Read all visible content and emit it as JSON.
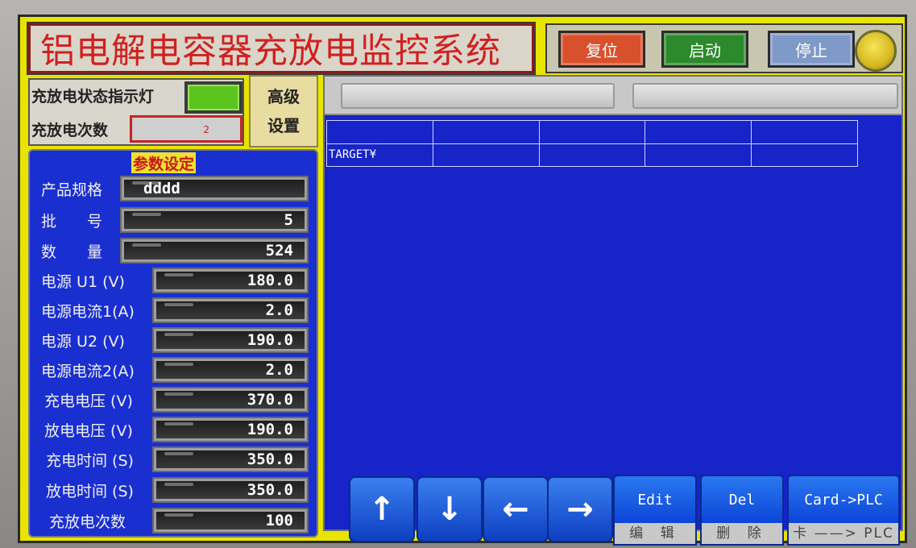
{
  "title": "铝电解电容器充放电监控系统",
  "top_buttons": {
    "reset": "复位",
    "start": "启动",
    "stop": "停止"
  },
  "status": {
    "lamp_label": "充放电状态指示灯",
    "count_label": "充放电次数",
    "count_value": "2"
  },
  "advanced": {
    "line1": "高级",
    "line2": "设置"
  },
  "params": {
    "title": "参数设定",
    "rows": [
      {
        "label": "产品规格",
        "value": "dddd"
      },
      {
        "label": "批　　号",
        "value": "5"
      },
      {
        "label": "数　　量",
        "value": "524"
      },
      {
        "label": "电源 U1  (V)",
        "value": "180.0"
      },
      {
        "label": "电源电流1(A)",
        "value": "2.0"
      },
      {
        "label": "电源 U2  (V)",
        "value": "190.0"
      },
      {
        "label": "电源电流2(A)",
        "value": "2.0"
      },
      {
        "label": "充电电压 (V)",
        "value": "370.0"
      },
      {
        "label": "放电电压 (V)",
        "value": "190.0"
      },
      {
        "label": "充电时间 (S)",
        "value": "350.0"
      },
      {
        "label": "放电时间 (S)",
        "value": "350.0"
      },
      {
        "label": "充放电次数",
        "value": "100"
      }
    ]
  },
  "grid": {
    "row1": [
      "",
      "",
      "",
      "",
      ""
    ],
    "row2": [
      "TARGET¥",
      "",
      "",
      "",
      ""
    ]
  },
  "nav": {
    "up": "↑",
    "down": "↓",
    "left": "←",
    "right": "→"
  },
  "ops": {
    "edit": {
      "label": "Edit",
      "sub": "编 辑"
    },
    "del": {
      "label": "Del",
      "sub": "删 除"
    },
    "card": {
      "label": "Card->PLC",
      "sub": "卡 ——> PLC"
    }
  },
  "colors": {
    "screen_bg": "#e8e400",
    "panel_blue": "#1624c8",
    "title_red": "#d12020",
    "status_lamp_green": "#5cc41e"
  }
}
